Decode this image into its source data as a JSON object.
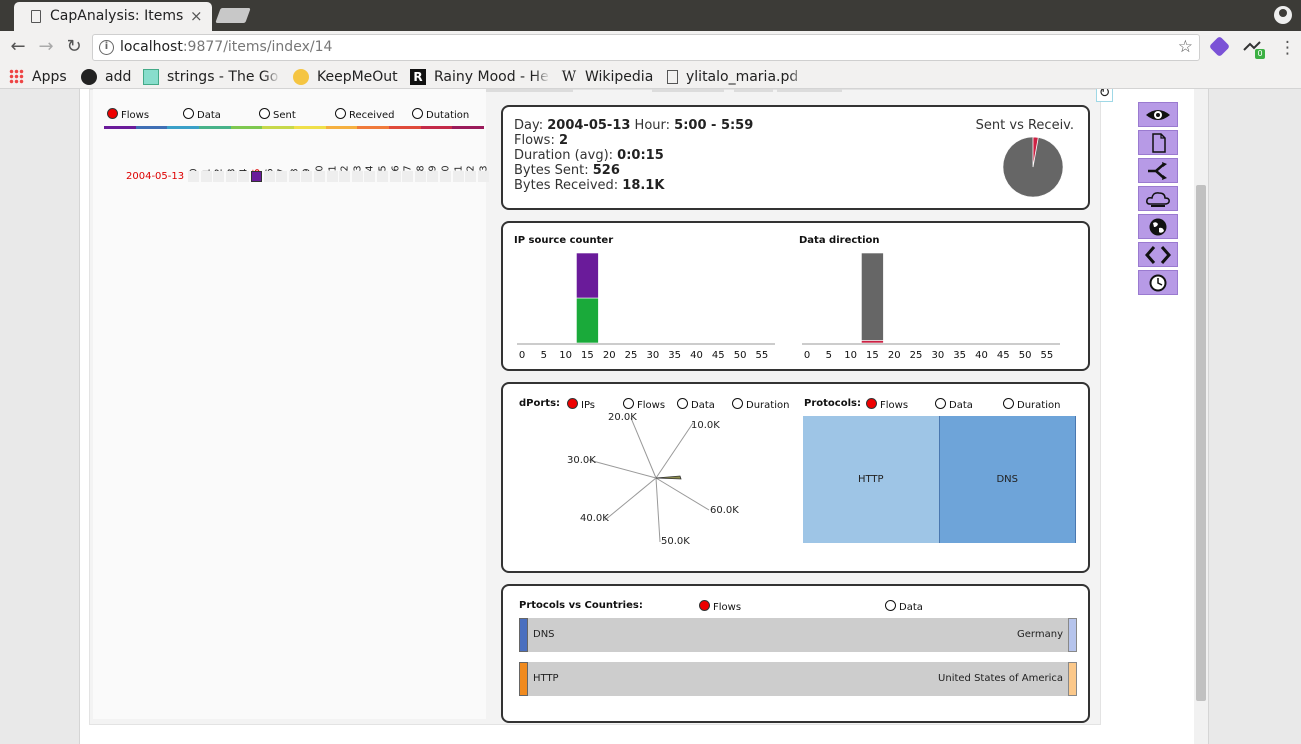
{
  "browser": {
    "tab_title": "CapAnalysis: Items",
    "tab_close": "×",
    "url_host": "localhost",
    "url_rest": ":9877/items/index/14",
    "bookmarks": [
      {
        "label": "Apps"
      },
      {
        "label": "add"
      },
      {
        "label": "strings - The Go"
      },
      {
        "label": "KeepMeOut"
      },
      {
        "label": "Rainy Mood - Hel"
      },
      {
        "label": "Wikipedia"
      },
      {
        "label": "ylitalo_maria.pd"
      }
    ],
    "ext_badge": "0"
  },
  "heatmap": {
    "options": [
      {
        "label": "Flows",
        "selected": true
      },
      {
        "label": "Data",
        "selected": false
      },
      {
        "label": "Sent",
        "selected": false
      },
      {
        "label": "Received",
        "selected": false
      },
      {
        "label": "Dutation",
        "selected": false
      }
    ],
    "hours": [
      "0",
      "1",
      "2",
      "3",
      "4",
      "5",
      "6",
      "7",
      "8",
      "9",
      "10",
      "11",
      "12",
      "13",
      "14",
      "15",
      "16",
      "17",
      "18",
      "19",
      "20",
      "21",
      "22",
      "23"
    ],
    "highlight_hour": "5",
    "date": "2004-05-13",
    "active_cell_index": 5,
    "rainbow": [
      "#6a1b9a",
      "#3f6fb5",
      "#3aa0c8",
      "#48b38a",
      "#7ec850",
      "#c6d84a",
      "#efe04a",
      "#f5b040",
      "#f07a3a",
      "#e04a3a",
      "#c42a48",
      "#9a1a5a"
    ]
  },
  "summary": {
    "day_label": "Day:",
    "day": "2004-05-13",
    "hour_label": "Hour:",
    "hour": "5:00 - 5:59",
    "flows_label": "Flows:",
    "flows": "2",
    "duration_label": "Duration (avg):",
    "duration": "0:0:15",
    "sent_label": "Bytes Sent:",
    "sent": "526",
    "received_label": "Bytes Received:",
    "received": "18.1K",
    "pie_title": "Sent vs Receiv.",
    "pie": {
      "sent": 526,
      "received": 18100,
      "sent_color": "#cc2244",
      "received_color": "#666666"
    }
  },
  "ip_source": {
    "title": "IP source counter",
    "ticks": [
      "0",
      "5",
      "10",
      "15",
      "20",
      "25",
      "30",
      "35",
      "40",
      "45",
      "50",
      "55"
    ]
  },
  "data_direction": {
    "title": "Data direction",
    "ticks": [
      "0",
      "5",
      "10",
      "15",
      "20",
      "25",
      "30",
      "35",
      "40",
      "45",
      "50",
      "55"
    ]
  },
  "dports": {
    "title": "dPorts:",
    "options": [
      {
        "label": "IPs",
        "selected": true
      },
      {
        "label": "Flows",
        "selected": false
      },
      {
        "label": "Data",
        "selected": false
      },
      {
        "label": "Duration",
        "selected": false
      }
    ],
    "labels": [
      "10.0K",
      "20.0K",
      "30.0K",
      "40.0K",
      "50.0K",
      "60.0K"
    ]
  },
  "protocols": {
    "title": "Protocols:",
    "options": [
      {
        "label": "Flows",
        "selected": true
      },
      {
        "label": "Data",
        "selected": false
      },
      {
        "label": "Duration",
        "selected": false
      }
    ],
    "items": [
      {
        "name": "HTTP",
        "value": 1,
        "color": "#9ec5e6"
      },
      {
        "name": "DNS",
        "value": 1,
        "color": "#6ea4d9"
      }
    ]
  },
  "countries": {
    "title": "Prtocols vs Countries:",
    "options": [
      {
        "label": "Flows",
        "selected": true
      },
      {
        "label": "Data",
        "selected": false
      }
    ],
    "rows": [
      {
        "protocol": "DNS",
        "country": "Germany",
        "left_color": "#4a6fbf",
        "right_color": "#b6c4ec"
      },
      {
        "protocol": "HTTP",
        "country": "United States of America",
        "left_color": "#f08a1e",
        "right_color": "#fbc88a"
      }
    ]
  },
  "chart_data": [
    {
      "type": "bar",
      "title": "IP source counter",
      "categories": [
        "15"
      ],
      "series": [
        {
          "values": [
            1
          ],
          "color": "#6a1b9a"
        },
        {
          "values": [
            1
          ],
          "color": "#1aaa3a"
        }
      ],
      "xlim": [
        0,
        58
      ],
      "ticks": [
        0,
        5,
        10,
        15,
        20,
        25,
        30,
        35,
        40,
        45,
        50,
        55
      ]
    },
    {
      "type": "bar",
      "title": "Data direction",
      "categories": [
        "15"
      ],
      "series": [
        {
          "values": [
            18100
          ],
          "color": "#666666"
        },
        {
          "values": [
            526
          ],
          "color": "#cc2244"
        }
      ],
      "xlim": [
        0,
        58
      ],
      "ticks": [
        0,
        5,
        10,
        15,
        20,
        25,
        30,
        35,
        40,
        45,
        50,
        55
      ]
    }
  ]
}
